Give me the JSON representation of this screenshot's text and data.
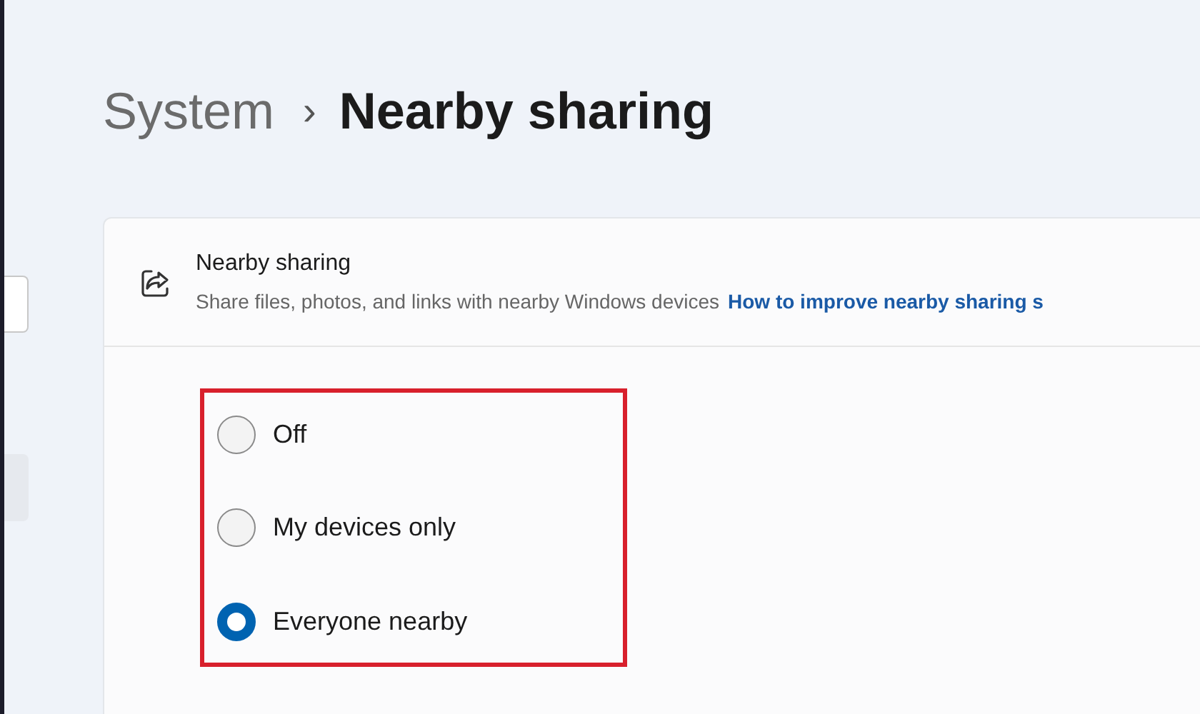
{
  "breadcrumb": {
    "parent": "System",
    "separator": "›",
    "current": "Nearby sharing"
  },
  "setting": {
    "title": "Nearby sharing",
    "description": "Share files, photos, and links with nearby Windows devices",
    "link": "How to improve nearby sharing s"
  },
  "options": [
    {
      "label": "Off",
      "selected": false
    },
    {
      "label": "My devices only",
      "selected": false
    },
    {
      "label": "Everyone nearby",
      "selected": true
    }
  ]
}
